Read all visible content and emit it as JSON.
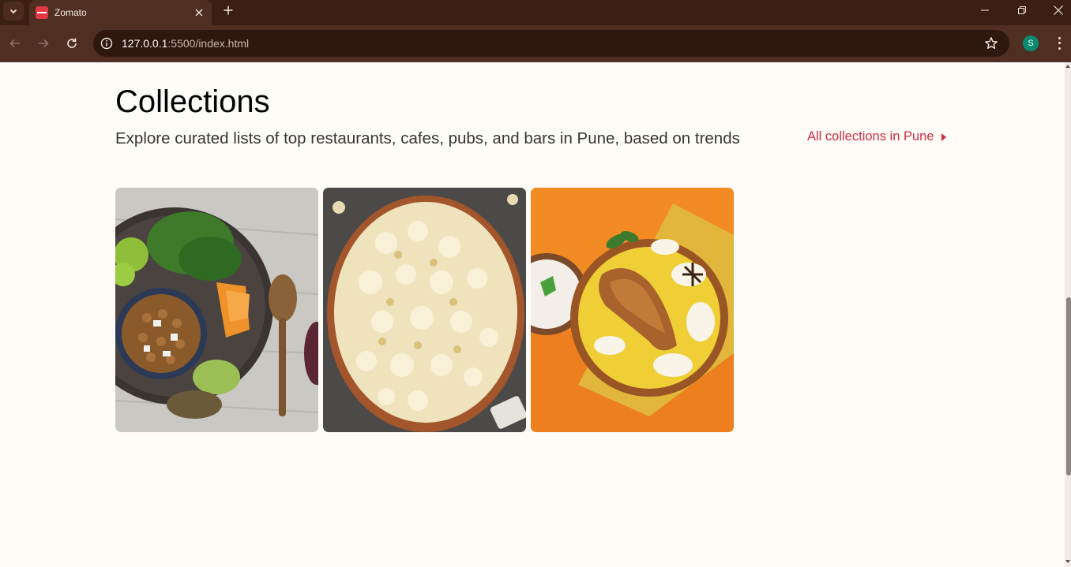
{
  "browser": {
    "tab_title": "Zomato",
    "url_host": "127.0.0.1",
    "url_rest": ":5500/index.html",
    "profile_initial": "S",
    "icons": [
      "tab-search-icon",
      "zomato-favicon",
      "close-icon",
      "plus-icon",
      "minimize-icon",
      "restore-icon",
      "close-window-icon",
      "back-arrow-icon",
      "forward-arrow-icon",
      "reload-icon",
      "info-icon",
      "star-icon",
      "kebab-menu-icon"
    ]
  },
  "page": {
    "heading": "Collections",
    "subtitle": "Explore curated lists of top restaurants, cafes, pubs, and bars in Pune, based on trends",
    "all_collections_link": "All collections in Pune",
    "accent_color": "#cf2e47",
    "collections": [
      {
        "image": "salad-bowl-photo"
      },
      {
        "image": "popcorn-bowl-photo"
      },
      {
        "image": "biryani-plate-photo"
      }
    ]
  }
}
